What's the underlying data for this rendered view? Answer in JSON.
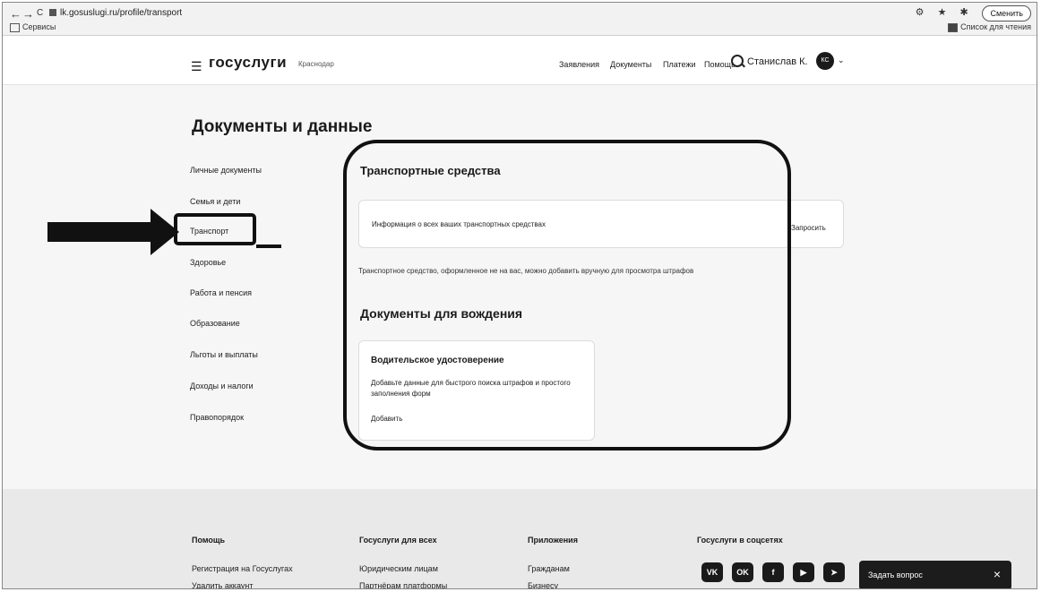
{
  "browser": {
    "back": "←",
    "forward": "→",
    "reload": "C",
    "url": "lk.gosuslugi.ru/profile/transport",
    "bookmarks_label": "Сервисы",
    "reading_list": "Список для чтения",
    "profile_button": "Сменить",
    "toolbar_icons": "⚙ ★ ✱ ⬇"
  },
  "header": {
    "logo": "госуслуги",
    "region": "Краснодар",
    "nav": [
      "Заявления",
      "Документы",
      "Платежи",
      "Помощь"
    ],
    "user_name": "Станислав К.",
    "avatar_initials": "КС"
  },
  "page": {
    "title": "Документы и данные",
    "sidebar": [
      "Личные документы",
      "Семья и дети",
      "Транспорт",
      "Здоровье",
      "Работа и пенсия",
      "Образование",
      "Льготы и выплаты",
      "Доходы и налоги",
      "Правопорядок"
    ]
  },
  "transport": {
    "section_title": "Транспортные средства",
    "card_text": "Информация о всех ваших транспортных средствах",
    "request_link": "Запросить",
    "note": "Транспортное средство, оформленное не на вас, можно добавить вручную для просмотра штрафов"
  },
  "driving": {
    "section_title": "Документы для вождения",
    "card_title": "Водительское удостоверение",
    "card_desc": "Добавьте данные для быстрого поиска штрафов и простого заполнения форм",
    "add_link": "Добавить"
  },
  "footer": {
    "col1": {
      "title": "Помощь",
      "link": "Регистрация на Госуслугах",
      "link2": "Удалить аккаунт"
    },
    "col2": {
      "title": "Госуслуги для всех",
      "link": "Юридическим лицам",
      "link2": "Партнёрам платформы"
    },
    "col3": {
      "title": "Приложения",
      "link": "Гражданам",
      "link2": "Бизнесу"
    },
    "col4": {
      "title": "Госуслуги в соцсетях"
    },
    "social": [
      "VK",
      "OK",
      "f",
      "▶",
      "➤"
    ],
    "ask_label": "Задать вопрос",
    "ask_close": "×"
  }
}
